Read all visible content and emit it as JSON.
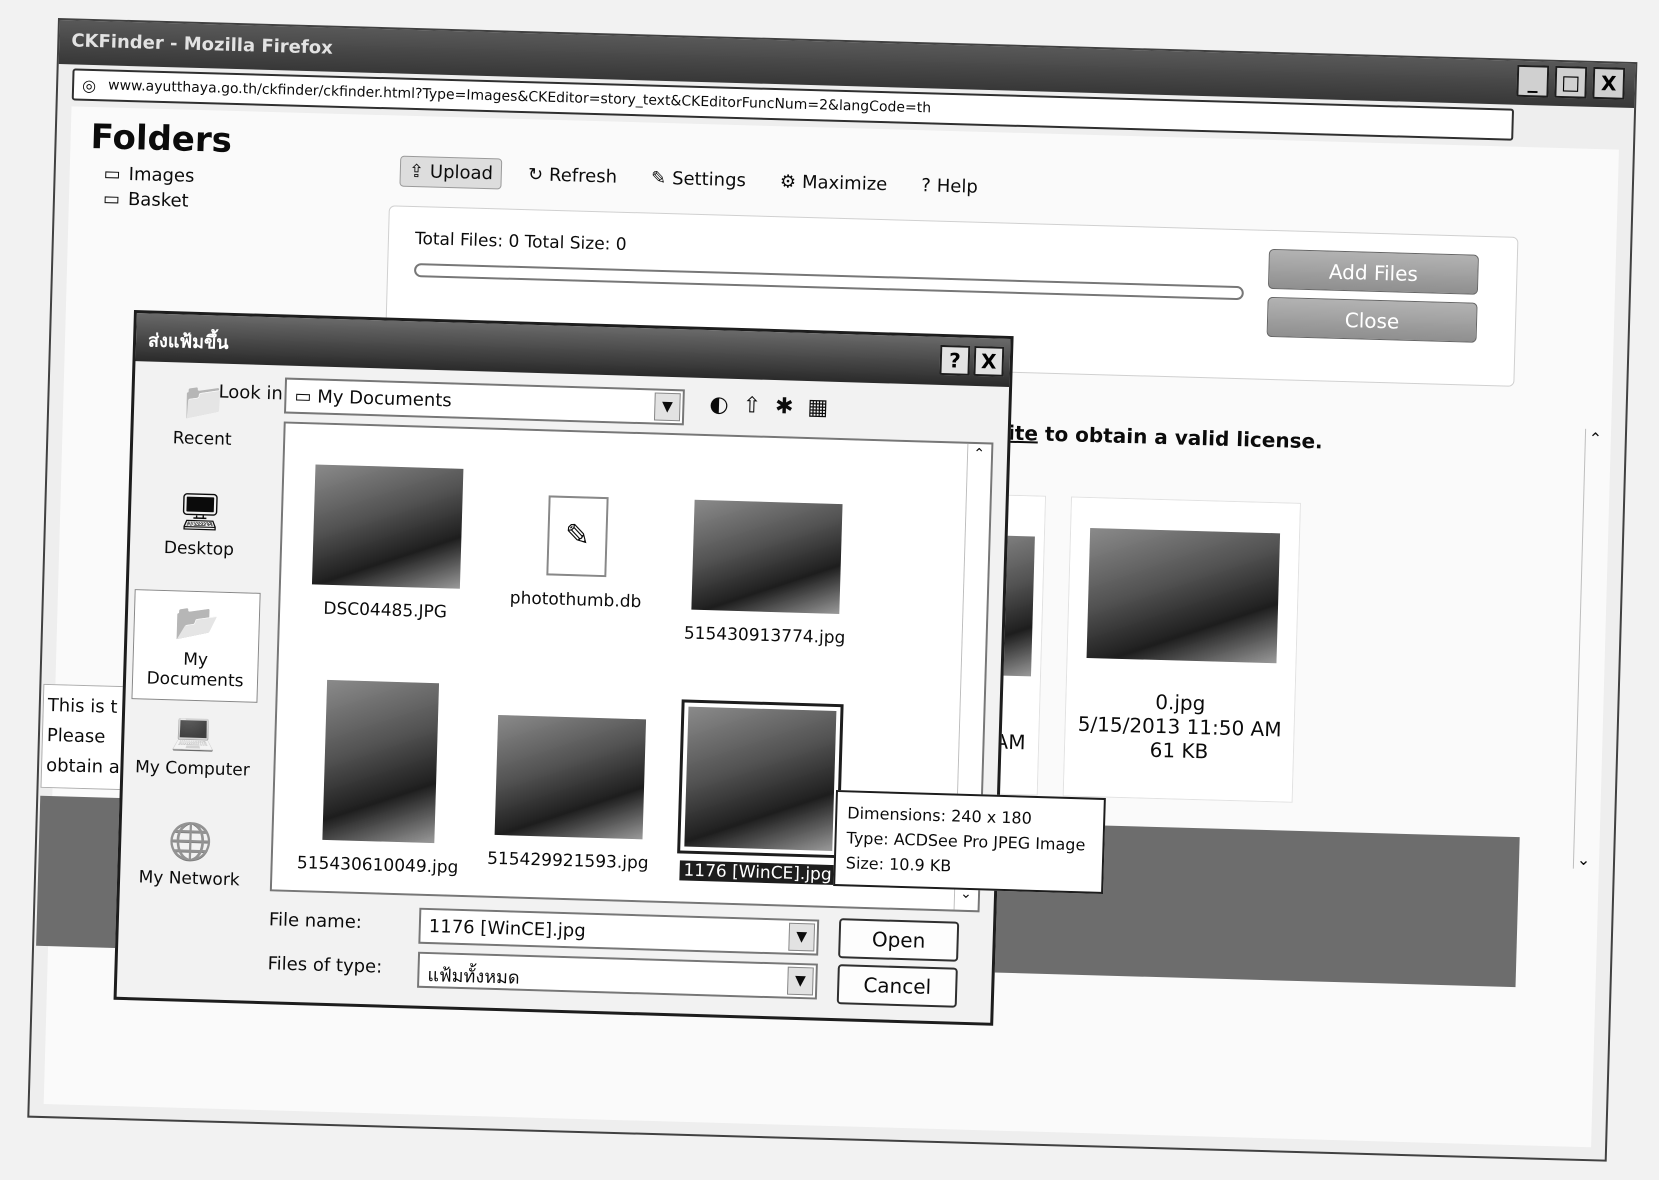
{
  "browser": {
    "title": "CKFinder - Mozilla Firefox",
    "url": "www.ayutthaya.go.th/ckfinder/ckfinder.html?Type=Images&CKEditor=story_text&CKEditorFuncNum=2&langCode=th",
    "window_buttons": [
      "_",
      "□",
      "X"
    ]
  },
  "folders": {
    "title": "Folders",
    "items": [
      "Images",
      "Basket"
    ]
  },
  "toolbar": {
    "upload": "Upload",
    "refresh": "Refresh",
    "settings": "Settings",
    "maximize": "Maximize",
    "help": "Help"
  },
  "upload_panel": {
    "info": "Total Files: 0 Total Size: 0",
    "progress": 0.0,
    "add_files": "Add Files",
    "close": "Close"
  },
  "license": {
    "link": "web site",
    "text": " to obtain a valid license."
  },
  "background_file": {
    "name": "0.jpg",
    "date": "5/15/2013 11:50 AM",
    "size": "61 KB",
    "partial_time": "50 AM"
  },
  "notice": {
    "line1": "This is t",
    "line2": "Please",
    "line3": "obtain a"
  },
  "dialog": {
    "title": "ส่งแฟ้มขึ้น",
    "help_btn": "?",
    "close_btn": "X",
    "look_in_label": "Look in:",
    "look_in_value": "My Documents",
    "places": [
      {
        "label": "Recent",
        "icon": "recent-icon"
      },
      {
        "label": "Desktop",
        "icon": "desktop-icon"
      },
      {
        "label": "My Documents",
        "icon": "my-documents-icon"
      },
      {
        "label": "My Computer",
        "icon": "my-computer-icon"
      },
      {
        "label": "My Network",
        "icon": "my-network-icon"
      }
    ],
    "files": [
      {
        "name": "DSC04485.JPG"
      },
      {
        "name": "photothumb.db"
      },
      {
        "name": "515430913774.jpg"
      },
      {
        "name": "515430610049.jpg"
      },
      {
        "name": "515429921593.jpg"
      },
      {
        "name": "1176 [WinCE].jpg",
        "selected": true
      }
    ],
    "file_name_label": "File name:",
    "file_name_value": "1176 [WinCE].jpg",
    "file_type_label": "Files of type:",
    "file_type_value": "แฟ้มทั้งหมด",
    "open": "Open",
    "cancel": "Cancel"
  },
  "tooltip": {
    "dimensions": "Dimensions: 240 x 180",
    "type": "Type: ACDSee Pro JPEG Image",
    "size": "Size: 10.9 KB"
  }
}
